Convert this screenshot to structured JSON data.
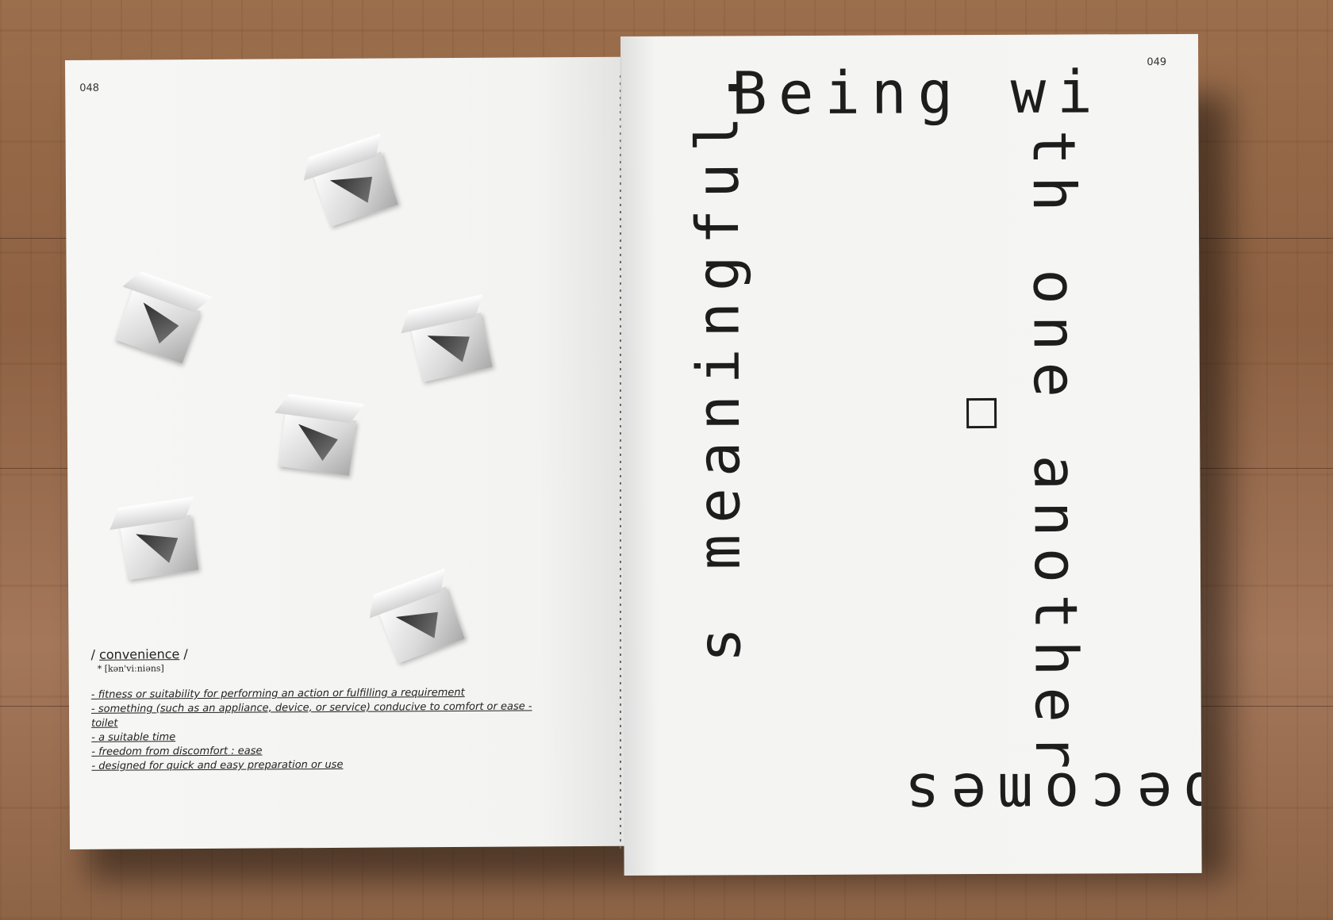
{
  "left_page": {
    "page_number": "048",
    "definition": {
      "term": "convenience",
      "term_prefix": "/",
      "term_suffix": "/",
      "phonetic": "* [kən'viːniəns]",
      "meanings": [
        "- fitness or suitability for performing an action or fulfilling a requirement",
        "- something (such as an appliance, device, or service) conducive to comfort or ease - toilet",
        "- a suitable time",
        "- freedom from discomfort : ease",
        "- designed for quick  and easy preparation or use"
      ]
    }
  },
  "right_page": {
    "page_number": "049",
    "typography": {
      "top_line": "Being wi",
      "right_vertical": "th one another",
      "bottom_upside_down": "becomes",
      "left_vertical": "s meaningful."
    }
  }
}
